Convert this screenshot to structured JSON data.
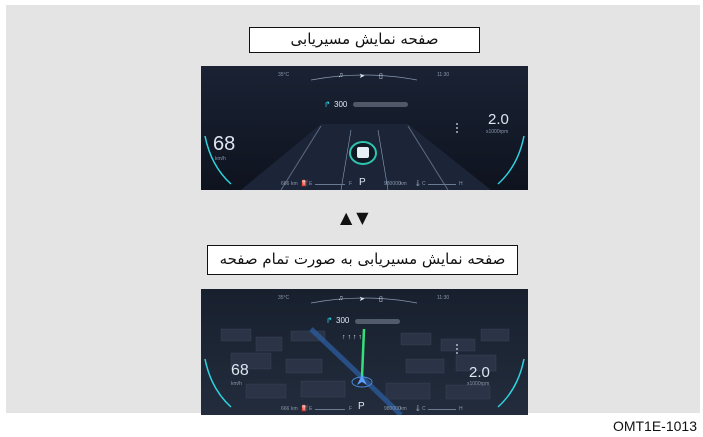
{
  "captions": {
    "nav_screen": "صفحه نمایش مسیریابی",
    "nav_fullscreen": "صفحه نمایش مسیریابی به صورت تمام صفحه"
  },
  "arrows": "▲▼",
  "figure_code": "OMT1E-1013",
  "cluster_top": {
    "temperature": "35°C",
    "time": "11:30",
    "distance": "300",
    "speed": "68",
    "speed_unit": "km/h",
    "rpm": "2.0",
    "rpm_unit": "x1000rpm",
    "gear": "P",
    "range": "666",
    "range_unit": "km",
    "fuel_empty": "E",
    "fuel_full": "F",
    "odometer": "980000",
    "odometer_unit": "km",
    "temp_cold": "C",
    "temp_hot": "H",
    "icons": [
      "music-icon",
      "navigation-icon",
      "phone-icon"
    ]
  },
  "cluster_bottom": {
    "temperature": "35°C",
    "time": "11:30",
    "distance": "300",
    "speed": "68",
    "speed_unit": "km/h",
    "rpm": "2.0",
    "rpm_unit": "x1000rpm",
    "gear": "P",
    "range": "666",
    "range_unit": "km",
    "fuel_empty": "E",
    "fuel_full": "F",
    "odometer": "980000",
    "odometer_unit": "km",
    "temp_cold": "C",
    "temp_hot": "H",
    "icons": [
      "music-icon",
      "navigation-icon",
      "phone-icon"
    ]
  },
  "colors": {
    "screen_bg": "#141a28",
    "accent_cyan": "#2fd4e0",
    "route_green": "#35e07a",
    "car_ring": "#2ec4b0"
  }
}
